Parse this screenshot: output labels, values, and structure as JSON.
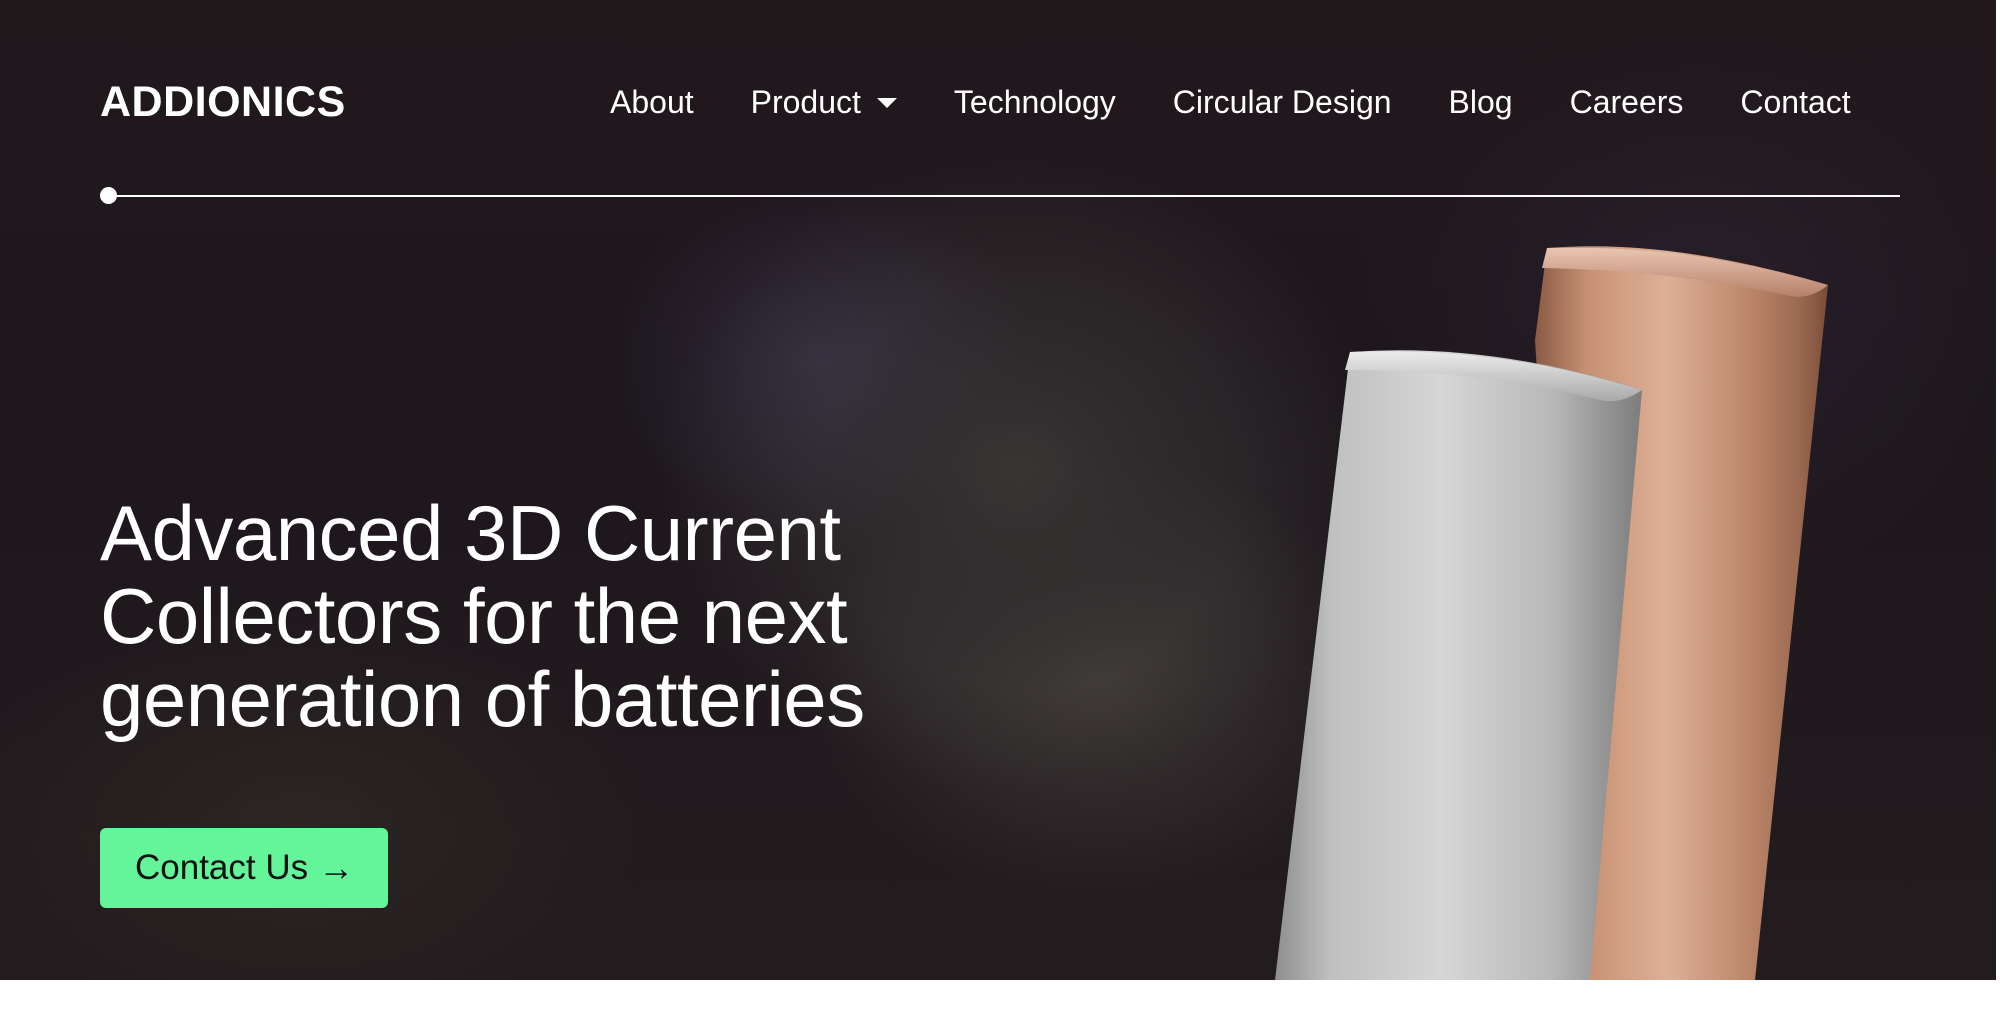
{
  "header": {
    "logo_text": "ADDIONICS",
    "nav": [
      {
        "label": "About"
      },
      {
        "label": "Product",
        "icon": "caret-down-icon"
      },
      {
        "label": "Technology"
      },
      {
        "label": "Circular Design"
      },
      {
        "label": "Blog"
      },
      {
        "label": "Careers"
      },
      {
        "label": "Contact"
      }
    ]
  },
  "hero": {
    "headline_lines": [
      "Advanced 3D Current",
      "Collectors for the next",
      "generation of batteries"
    ],
    "cta_label": "Contact Us",
    "cta_icon": "arrow-right-icon",
    "image": "copper-and-aluminum-foil-rolls"
  },
  "colors": {
    "background": "#1f181c",
    "text": "#ffffff",
    "cta": "#64f59b",
    "copper": "#c98f73",
    "aluminum": "#b8b8b8"
  }
}
